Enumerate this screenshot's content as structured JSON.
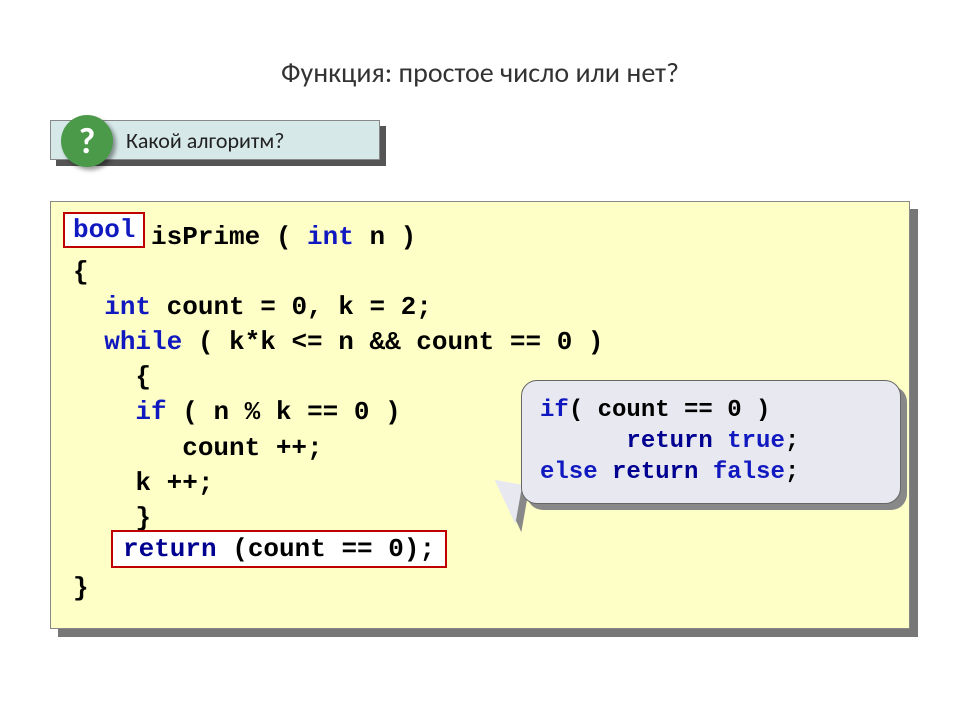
{
  "title": "Функция: простое число или нет?",
  "question": {
    "icon": "?",
    "text": "Какой алгоритм?"
  },
  "code": {
    "bool_label": "bool",
    "line1a": "     isPrime ( ",
    "line1_kw": "int",
    "line1b": " n )",
    "line2": "{",
    "line3a": "  ",
    "line3_kw": "int",
    "line3b": " count = 0, k = 2;",
    "line4a": "  ",
    "line4_kw": "while",
    "line4b": " ( k*k <= n && count == 0 )",
    "line5": "    {",
    "line6a": "    ",
    "line6_kw": "if",
    "line6b": " ( n % k == 0 )",
    "line7": "       count ++;",
    "line8": "    k ++;",
    "line9": "    }",
    "line10": "",
    "line11": "}"
  },
  "return_box": {
    "kw": "return",
    "rest": " (count == 0);"
  },
  "callout": {
    "l1_kw": "if",
    "l1_rest": "( count == 0 )",
    "l2_pre": "      ",
    "l2_kw": "return",
    "l2_sp": " ",
    "l2_val": "true",
    "l2_end": ";",
    "l3_kw1": "else",
    "l3_sp": " ",
    "l3_kw2": "return",
    "l3_sp2": " ",
    "l3_val": "false",
    "l3_end": ";"
  }
}
